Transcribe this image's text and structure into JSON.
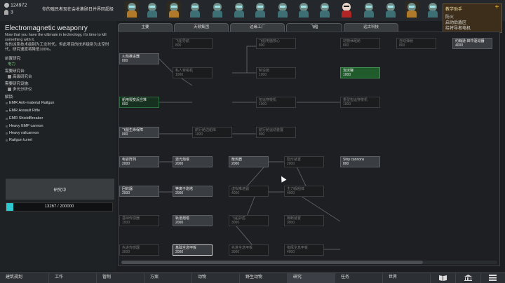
{
  "colors": {
    "accent": "#2ec8d0",
    "completed": "#1f5b2b",
    "alert_bg": "#3c2e1a"
  },
  "topbar": {
    "silver": "124972",
    "colonist_count": "3",
    "message": "你的殖民者现在会收集顾日并界回超级"
  },
  "alerts": {
    "header": "教学助手",
    "items": [
      "防火",
      "启动后盾区",
      "给将导者电机"
    ]
  },
  "project": {
    "title": "Electromagnetic weaponry",
    "description": "Now that you have the ultimate in technology, it's time to kill something with it.",
    "description_cn": "你的派系技术级别为工业时代。但此项目的技术级别为太空时代，研究速度将降低100%。",
    "prereq_label": "前置研究:",
    "prereq_value": "电力",
    "bench_label": "需要研究台:",
    "bench_value": "高级研究台",
    "facility_label": "需要研究设施:",
    "facility_value": "多元分析仪",
    "unlocks_label": "解锁:",
    "unlocks": [
      "EMR Anti-material Railgun",
      "EMR Assault Rifle",
      "EMR ShieldBreaker",
      "Heavy EMP cannon",
      "Heavy railcannon",
      "Railgun turret"
    ],
    "research_button": "研究中",
    "progress_text": "13267 / 200000",
    "progress_fraction": 0.066
  },
  "tabs": [
    "主要",
    "天顿集团",
    "边缘工厂",
    "飞船",
    "远古科技"
  ],
  "active_tab": "飞船",
  "nodes": [
    {
      "name": "飞船导航",
      "cost": "800"
    },
    {
      "name": "飞船电脑核心",
      "cost": "800"
    },
    {
      "name": "动物休眠舱",
      "cost": "800"
    },
    {
      "name": "自动弹射",
      "cost": "800"
    },
    {
      "name": "约翰逊-田中驱动器",
      "cost": "4000"
    },
    {
      "name": "火箭推进器",
      "cost": "000"
    },
    {
      "name": "私人穿梭机",
      "cost": "1000"
    },
    {
      "name": "制设施",
      "cost": "1000"
    },
    {
      "name": "泡沫罐",
      "cost": "1000"
    },
    {
      "name": "船用裂变反应堆",
      "cost": "000"
    },
    {
      "name": "担运穿梭机",
      "cost": "1000"
    },
    {
      "name": "重型担运穿梭机",
      "cost": "1000"
    },
    {
      "name": "飞船生命保障",
      "cost": "000"
    },
    {
      "name": "航行舱边船库",
      "cost": "1000"
    },
    {
      "name": "航行舱运动装置",
      "cost": "800"
    },
    {
      "name": "电容阵列",
      "cost": "2000"
    },
    {
      "name": "激光炮塔",
      "cost": "2000"
    },
    {
      "name": "散热器",
      "cost": "2000"
    },
    {
      "name": "隐形装置",
      "cost": "2000"
    },
    {
      "name": "Ship cannons",
      "cost": "800"
    },
    {
      "name": "回收器",
      "cost": "2000"
    },
    {
      "name": "等离子炮塔",
      "cost": "2000"
    },
    {
      "name": "虚拟推进器",
      "cost": "4000"
    },
    {
      "name": "主力舰船体",
      "cost": "4000"
    },
    {
      "name": "基础传感器",
      "cost": "1000"
    },
    {
      "name": "轨道炮塔",
      "cost": "2000"
    },
    {
      "name": "飞船护盾",
      "cost": "3000"
    },
    {
      "name": "隔断装置",
      "cost": "3000"
    },
    {
      "name": "先进传感器",
      "cost": "3000"
    },
    {
      "name": "基础全息甲板",
      "cost": "2000"
    },
    {
      "name": "先进全息甲板",
      "cost": "3000"
    },
    {
      "name": "指挥全息甲板",
      "cost": "4000"
    }
  ],
  "bottombar": [
    "建筑规划",
    "工作",
    "管制",
    "方案",
    "动物",
    "野生动物",
    "研究",
    "任务",
    "世界"
  ]
}
